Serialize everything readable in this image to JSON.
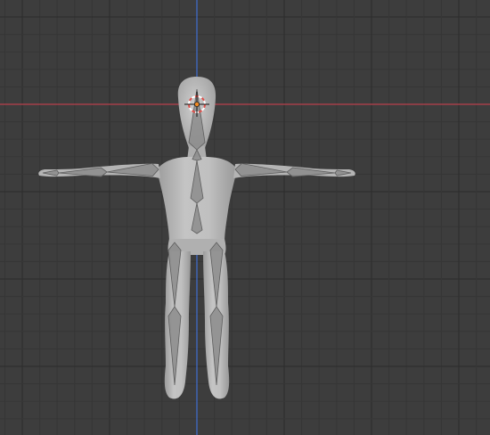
{
  "viewport": {
    "mode": "front-orthographic",
    "background_color": "#3d3d3d",
    "grid": true,
    "minor_grid_color": "#363636",
    "major_grid_color": "#2c2c2c",
    "x_axis_color": "#b9404c",
    "z_axis_color": "#3f6dd1"
  },
  "scene": {
    "mesh": {
      "type": "humanoid-t-pose",
      "color": "#b8b8b8",
      "shade_color": "#9a9a9a"
    },
    "armature": {
      "bone_color": "#8c8c8c",
      "bone_edge_color": "#5e5e5e"
    },
    "cursor": {
      "ring_color_a": "#e0504a",
      "ring_color_b": "#ffffff",
      "origin_color": "#f08a24"
    }
  }
}
